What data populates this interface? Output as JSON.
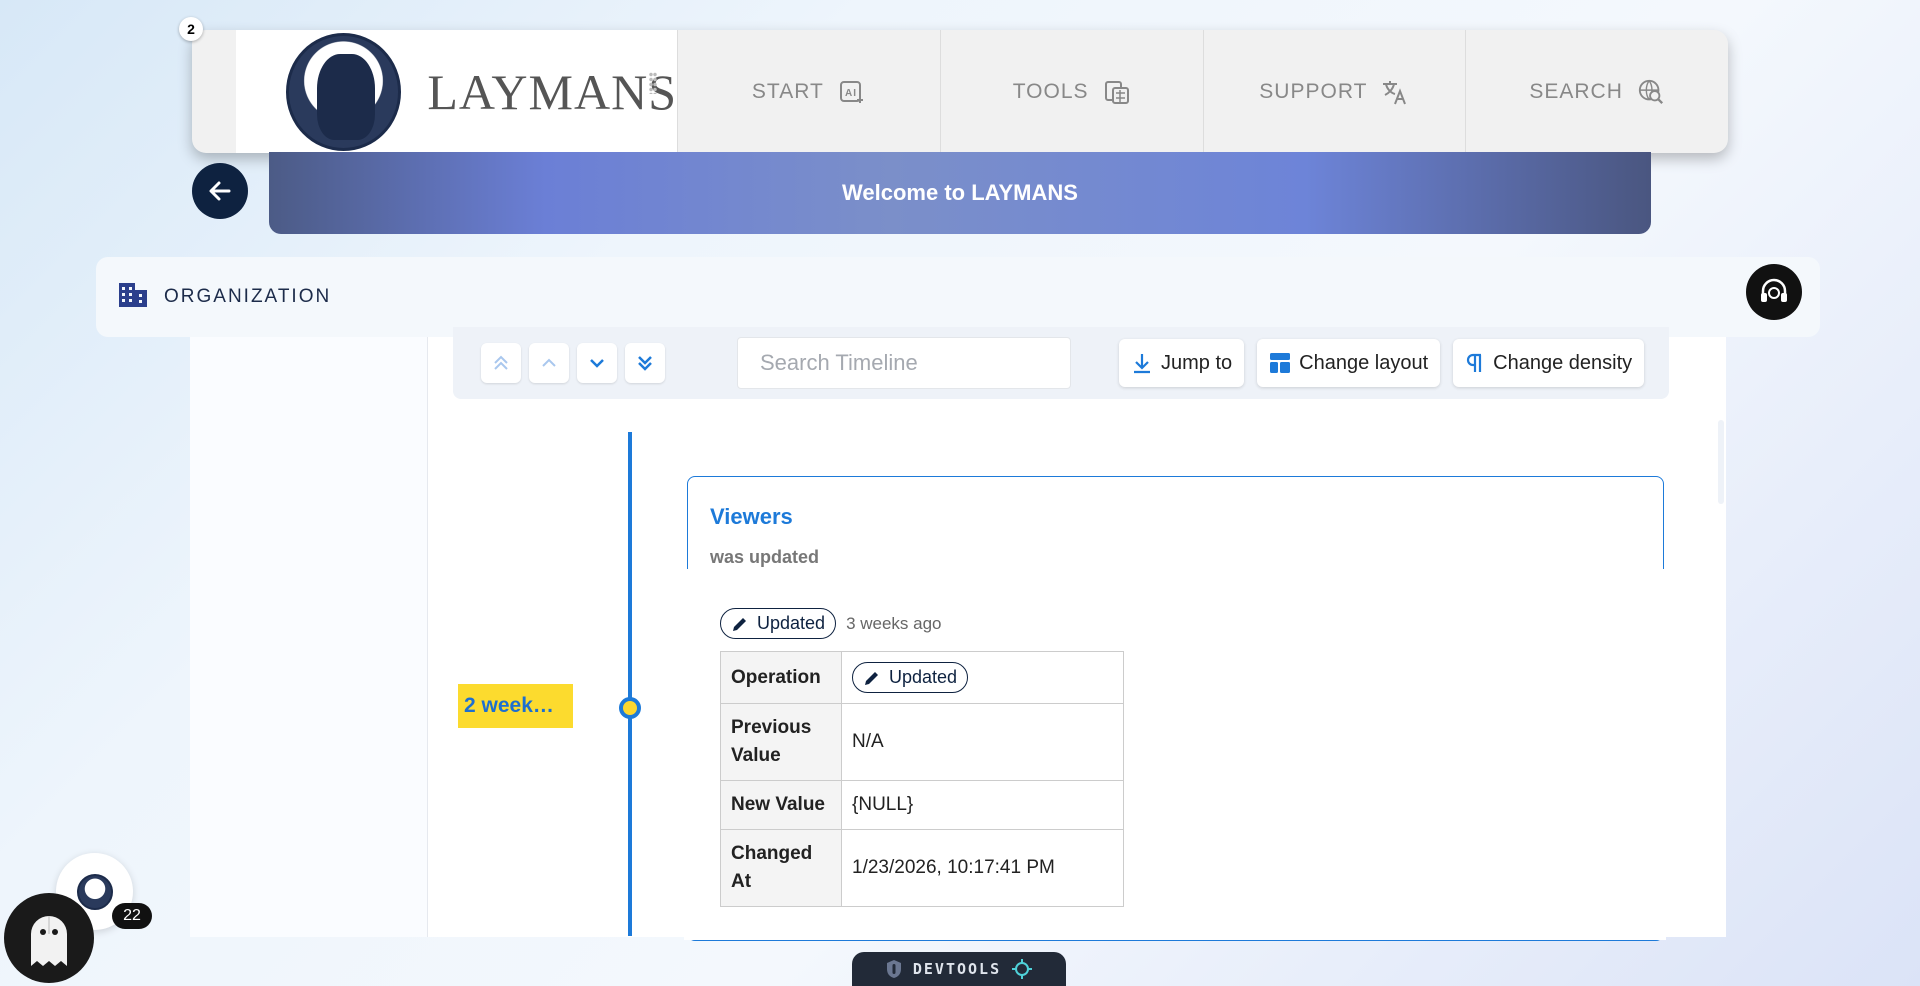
{
  "header": {
    "notification_count": "2",
    "logo_text": "LAYMANS",
    "nav": [
      {
        "label": "START",
        "icon": "ai-sparkle-icon"
      },
      {
        "label": "TOOLS",
        "icon": "calculator-icon"
      },
      {
        "label": "SUPPORT",
        "icon": "translate-icon"
      },
      {
        "label": "SEARCH",
        "icon": "search-globe-icon"
      }
    ]
  },
  "banner": {
    "text": "Welcome to LAYMANS"
  },
  "org": {
    "label": "ORGANIZATION"
  },
  "toolbar": {
    "search_placeholder": "Search Timeline",
    "jump_label": "Jump to",
    "layout_label": "Change layout",
    "density_label": "Change density"
  },
  "timeline": {
    "time_tag": "2 week…",
    "entry": {
      "title": "Viewers",
      "subtitle": "was updated",
      "chip_label": "Updated",
      "relative_time": "3 weeks ago",
      "rows": [
        {
          "key": "Operation",
          "value": "Updated",
          "chip": true
        },
        {
          "key": "Previous Value",
          "value": "N/A"
        },
        {
          "key": "New Value",
          "value": "{NULL}"
        },
        {
          "key": "Changed At",
          "value": "1/23/2026, 10:17:41 PM"
        }
      ]
    }
  },
  "bottom": {
    "count": "22",
    "devtools_label": "DEVTOOLS"
  },
  "colors": {
    "accent": "#1d7ad9",
    "navy": "#0e2240",
    "highlight": "#fcdb2e"
  }
}
